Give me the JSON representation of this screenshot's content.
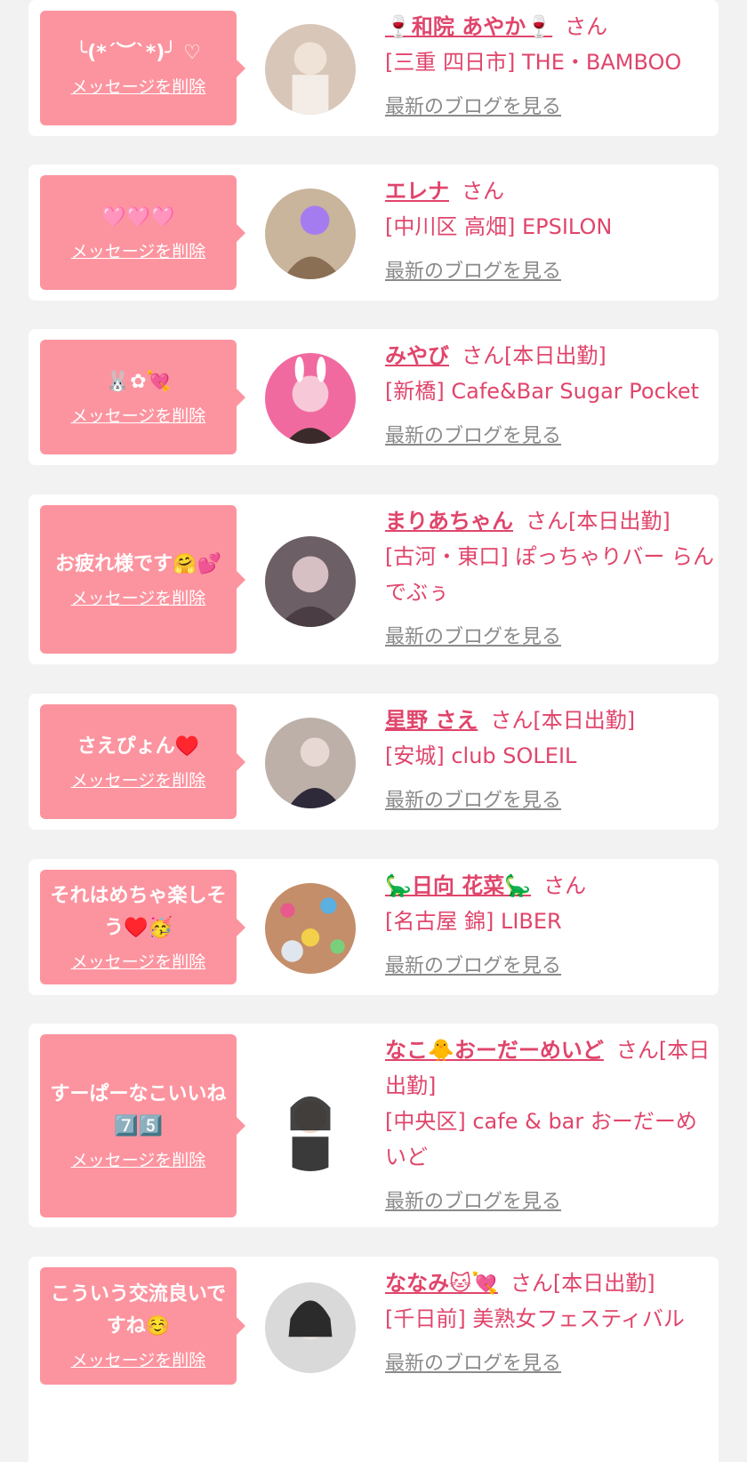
{
  "delete_label": "メッセージを削除",
  "blog_label": "最新のブログを見る",
  "entries": [
    {
      "message": "╰(*´︶`*)╯ ♡",
      "name": "🍷和院 あやか🍷",
      "suffix": "さん",
      "shop": "[三重 四日市] THE・BAMBOO",
      "avatar_color": "#d8c6b8"
    },
    {
      "message": "🩷🩷🩷",
      "name": "エレナ",
      "suffix": "さん",
      "shop": "[中川区 高畑] EPSILON",
      "avatar_color": "#c9b49c"
    },
    {
      "message": "🐰✿💘",
      "name": "みやび",
      "suffix": "さん[本日出勤]",
      "shop": "[新橋] Cafe&Bar Sugar Pocket",
      "avatar_color": "#f06aa0"
    },
    {
      "message": "お疲れ様です🤗💕",
      "name": "まりあちゃん",
      "suffix": "さん[本日出勤]",
      "shop": "[古河・東口] ぽっちゃりバー らんでぶぅ",
      "avatar_color": "#6c5f66"
    },
    {
      "message": "さえぴょん♥️",
      "name": "星野 さえ",
      "suffix": "さん[本日出勤]",
      "shop": "[安城] club SOLEIL",
      "avatar_color": "#bcb0a8"
    },
    {
      "message": "それはめちゃ楽しそう♥️🥳",
      "name": "🦕日向 花菜🦕",
      "suffix": "さん",
      "shop": "[名古屋 錦] LIBER",
      "avatar_color": "#c48e6a"
    },
    {
      "message": "すーぱーなこいいね7️⃣5️⃣",
      "name": "なこ🐥おーだーめいど",
      "suffix": "さん[本日出勤]",
      "shop": "[中央区] cafe & bar おーだーめいど",
      "avatar_color": "#3a3a3a"
    },
    {
      "message": "こういう交流良いですね☺️",
      "name": "ななみ🐱💘",
      "suffix": "さん[本日出勤]",
      "shop": "[千日前] 美熟女フェスティバル",
      "avatar_color": "#2b2b2b"
    }
  ]
}
